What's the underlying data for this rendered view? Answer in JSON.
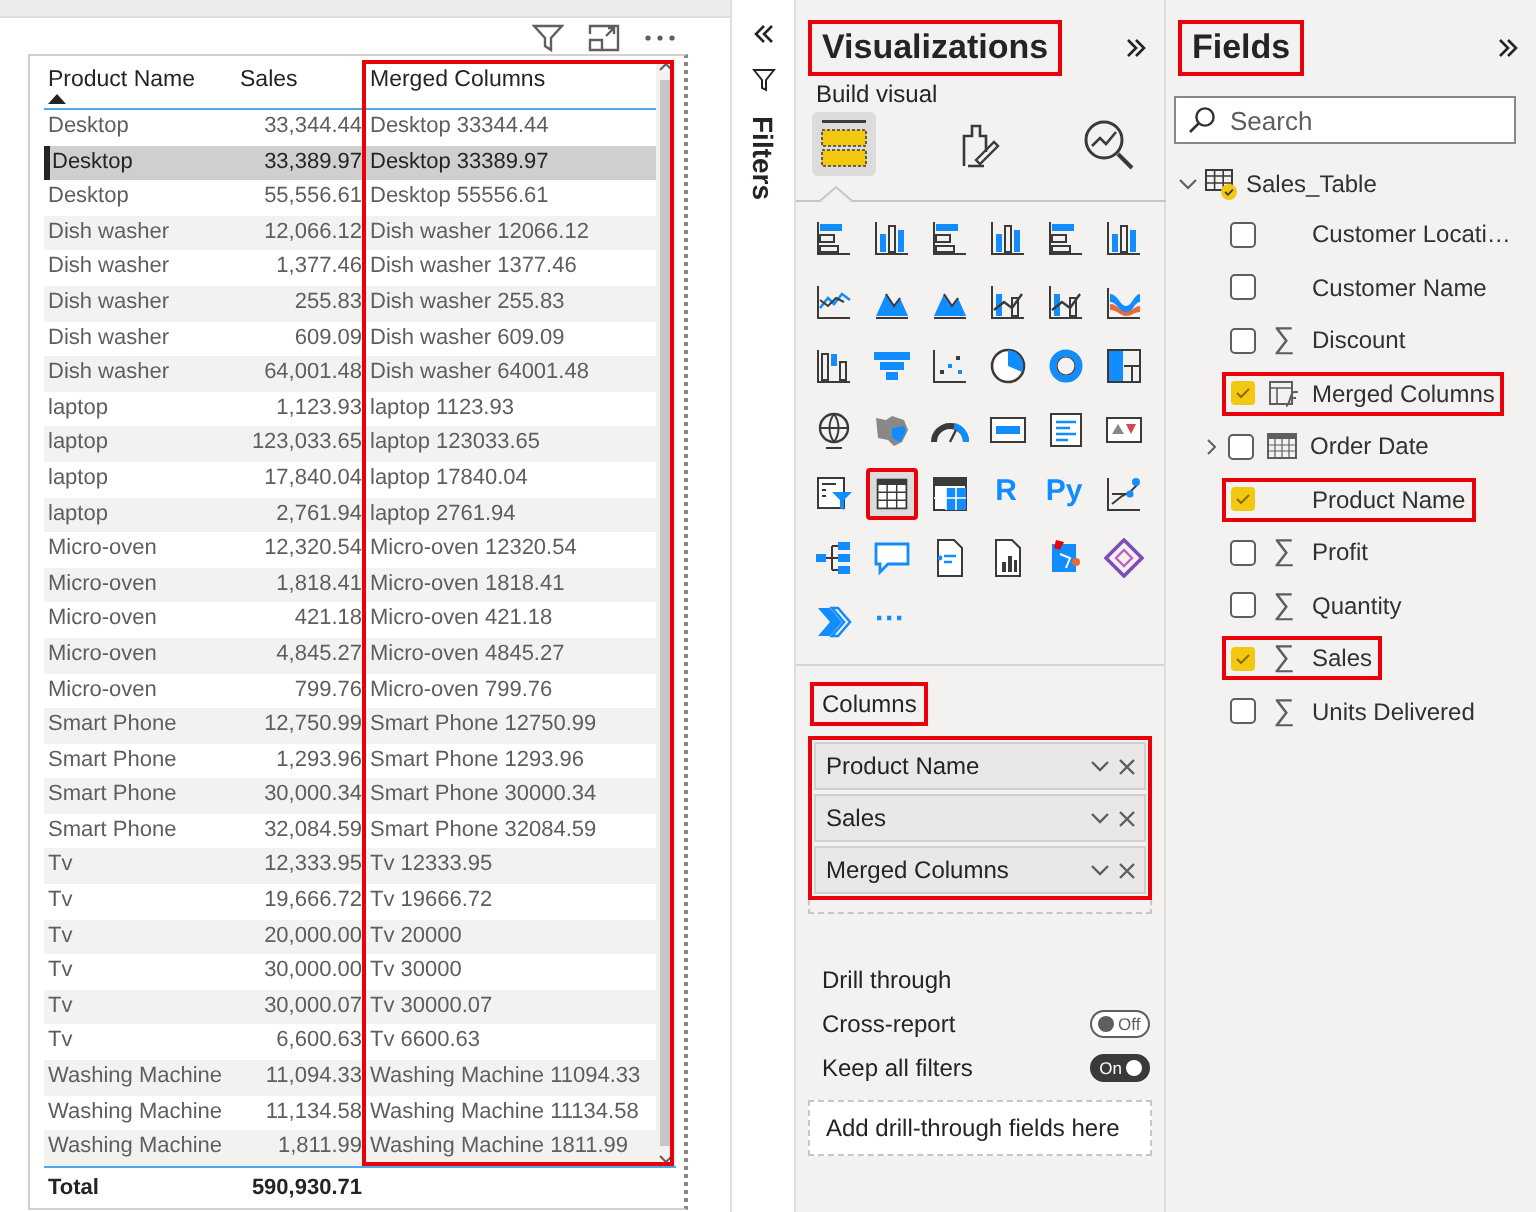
{
  "table_visual": {
    "columns": [
      {
        "label": "Product Name",
        "kind": "text",
        "sorted": true,
        "highlighted": false
      },
      {
        "label": "Sales",
        "kind": "number",
        "sorted": false,
        "highlighted": false
      },
      {
        "label": "Merged Columns",
        "kind": "text",
        "sorted": false,
        "highlighted": true
      }
    ],
    "rows": [
      {
        "cells": [
          "Desktop",
          "33,344.44",
          "Desktop 33344.44"
        ],
        "selected": false
      },
      {
        "cells": [
          "Desktop",
          "33,389.97",
          "Desktop 33389.97"
        ],
        "selected": true
      },
      {
        "cells": [
          "Desktop",
          "55,556.61",
          "Desktop 55556.61"
        ],
        "selected": false
      },
      {
        "cells": [
          "Dish washer",
          "12,066.12",
          "Dish washer 12066.12"
        ],
        "selected": false
      },
      {
        "cells": [
          "Dish washer",
          "1,377.46",
          "Dish washer 1377.46"
        ],
        "selected": false
      },
      {
        "cells": [
          "Dish washer",
          "255.83",
          "Dish washer 255.83"
        ],
        "selected": false
      },
      {
        "cells": [
          "Dish washer",
          "609.09",
          "Dish washer 609.09"
        ],
        "selected": false
      },
      {
        "cells": [
          "Dish washer",
          "64,001.48",
          "Dish washer 64001.48"
        ],
        "selected": false
      },
      {
        "cells": [
          "laptop",
          "1,123.93",
          "laptop 1123.93"
        ],
        "selected": false
      },
      {
        "cells": [
          "laptop",
          "123,033.65",
          "laptop 123033.65"
        ],
        "selected": false
      },
      {
        "cells": [
          "laptop",
          "17,840.04",
          "laptop 17840.04"
        ],
        "selected": false
      },
      {
        "cells": [
          "laptop",
          "2,761.94",
          "laptop 2761.94"
        ],
        "selected": false
      },
      {
        "cells": [
          "Micro-oven",
          "12,320.54",
          "Micro-oven 12320.54"
        ],
        "selected": false
      },
      {
        "cells": [
          "Micro-oven",
          "1,818.41",
          "Micro-oven 1818.41"
        ],
        "selected": false
      },
      {
        "cells": [
          "Micro-oven",
          "421.18",
          "Micro-oven 421.18"
        ],
        "selected": false
      },
      {
        "cells": [
          "Micro-oven",
          "4,845.27",
          "Micro-oven 4845.27"
        ],
        "selected": false
      },
      {
        "cells": [
          "Micro-oven",
          "799.76",
          "Micro-oven 799.76"
        ],
        "selected": false
      },
      {
        "cells": [
          "Smart Phone",
          "12,750.99",
          "Smart Phone 12750.99"
        ],
        "selected": false
      },
      {
        "cells": [
          "Smart Phone",
          "1,293.96",
          "Smart Phone 1293.96"
        ],
        "selected": false
      },
      {
        "cells": [
          "Smart Phone",
          "30,000.34",
          "Smart Phone 30000.34"
        ],
        "selected": false
      },
      {
        "cells": [
          "Smart Phone",
          "32,084.59",
          "Smart Phone 32084.59"
        ],
        "selected": false
      },
      {
        "cells": [
          "Tv",
          "12,333.95",
          "Tv 12333.95"
        ],
        "selected": false
      },
      {
        "cells": [
          "Tv",
          "19,666.72",
          "Tv 19666.72"
        ],
        "selected": false
      },
      {
        "cells": [
          "Tv",
          "20,000.00",
          "Tv 20000"
        ],
        "selected": false
      },
      {
        "cells": [
          "Tv",
          "30,000.00",
          "Tv 30000"
        ],
        "selected": false
      },
      {
        "cells": [
          "Tv",
          "30,000.07",
          "Tv 30000.07"
        ],
        "selected": false
      },
      {
        "cells": [
          "Tv",
          "6,600.63",
          "Tv 6600.63"
        ],
        "selected": false
      },
      {
        "cells": [
          "Washing Machine",
          "11,094.33",
          "Washing Machine 11094.33"
        ],
        "selected": false
      },
      {
        "cells": [
          "Washing Machine",
          "11,134.58",
          "Washing Machine 11134.58"
        ],
        "selected": false
      },
      {
        "cells": [
          "Washing Machine",
          "1,811.99",
          "Washing Machine 1811.99"
        ],
        "selected": false
      }
    ],
    "total": [
      "Total",
      "590,930.71"
    ]
  },
  "filters_pane": {
    "title": "Filters"
  },
  "visualizations_pane": {
    "title": "Visualizations",
    "title_highlighted": true,
    "subtitle": "Build visual",
    "build_tabs": [
      {
        "kind": "fields",
        "selected": true
      },
      {
        "kind": "format",
        "selected": false
      },
      {
        "kind": "analytics",
        "selected": false
      }
    ],
    "visual_types": [
      {
        "kind": "hbar",
        "selected": false
      },
      {
        "kind": "vbar",
        "selected": false
      },
      {
        "kind": "hbar",
        "selected": false
      },
      {
        "kind": "vbar",
        "selected": false
      },
      {
        "kind": "hbar",
        "selected": false
      },
      {
        "kind": "vbar",
        "selected": false
      },
      {
        "kind": "line",
        "selected": false
      },
      {
        "kind": "area",
        "selected": false
      },
      {
        "kind": "area",
        "selected": false
      },
      {
        "kind": "combo",
        "selected": false
      },
      {
        "kind": "combo",
        "selected": false
      },
      {
        "kind": "ribbon",
        "selected": false
      },
      {
        "kind": "waterfall",
        "selected": false
      },
      {
        "kind": "funnel",
        "selected": false
      },
      {
        "kind": "scatter",
        "selected": false
      },
      {
        "kind": "pie",
        "selected": false
      },
      {
        "kind": "donut",
        "selected": false
      },
      {
        "kind": "treemap",
        "selected": false
      },
      {
        "kind": "globe",
        "selected": false
      },
      {
        "kind": "shapemap",
        "selected": false
      },
      {
        "kind": "gauge",
        "selected": false
      },
      {
        "kind": "card",
        "selected": false
      },
      {
        "kind": "list",
        "selected": false
      },
      {
        "kind": "kpi",
        "selected": false
      },
      {
        "kind": "slicer",
        "selected": false
      },
      {
        "kind": "table",
        "selected": true
      },
      {
        "kind": "matrix",
        "selected": false
      },
      {
        "kind": "text",
        "label": "R",
        "selected": false
      },
      {
        "kind": "text",
        "label": "Py",
        "selected": false
      },
      {
        "kind": "influencers",
        "selected": false
      },
      {
        "kind": "tree",
        "selected": false
      },
      {
        "kind": "speech",
        "selected": false
      },
      {
        "kind": "document",
        "selected": false
      },
      {
        "kind": "report",
        "selected": false
      },
      {
        "kind": "app",
        "selected": false
      },
      {
        "kind": "diamond",
        "selected": false
      },
      {
        "kind": "chevron",
        "selected": false
      },
      {
        "kind": "text",
        "label": "···",
        "selected": false
      }
    ],
    "well": {
      "label": "Columns",
      "highlighted": true,
      "fields": [
        "Product Name",
        "Sales",
        "Merged Columns"
      ]
    },
    "drill_through": {
      "title": "Drill through",
      "toggles": [
        {
          "label": "Cross-report",
          "on": false,
          "state_text": "Off"
        },
        {
          "label": "Keep all filters",
          "on": true,
          "state_text": "On"
        }
      ],
      "drop_hint": "Add drill-through fields here"
    }
  },
  "fields_pane": {
    "title": "Fields",
    "title_highlighted": true,
    "search": {
      "placeholder": "Search"
    },
    "tables": [
      {
        "label": "Sales_Table",
        "expanded": true,
        "children": [
          {
            "label": "Customer Locati…",
            "kind": "text",
            "checked": false,
            "highlighted": false
          },
          {
            "label": "Customer Name",
            "kind": "text",
            "checked": false,
            "highlighted": false
          },
          {
            "label": "Discount",
            "kind": "measure",
            "symbol": "∑",
            "checked": false,
            "highlighted": false
          },
          {
            "label": "Merged Columns",
            "kind": "calculated",
            "checked": true,
            "highlighted": true
          },
          {
            "label": "Order Date",
            "kind": "date",
            "expanded": false,
            "checked": false,
            "highlighted": false
          },
          {
            "label": "Product Name",
            "kind": "text",
            "checked": true,
            "highlighted": true
          },
          {
            "label": "Profit",
            "kind": "measure",
            "symbol": "∑",
            "checked": false,
            "highlighted": false
          },
          {
            "label": "Quantity",
            "kind": "measure",
            "symbol": "∑",
            "checked": false,
            "highlighted": false
          },
          {
            "label": "Sales",
            "kind": "measure",
            "symbol": "∑",
            "checked": true,
            "highlighted": true
          },
          {
            "label": "Units Delivered",
            "kind": "measure",
            "symbol": "∑",
            "checked": false,
            "highlighted": false
          }
        ]
      }
    ]
  }
}
